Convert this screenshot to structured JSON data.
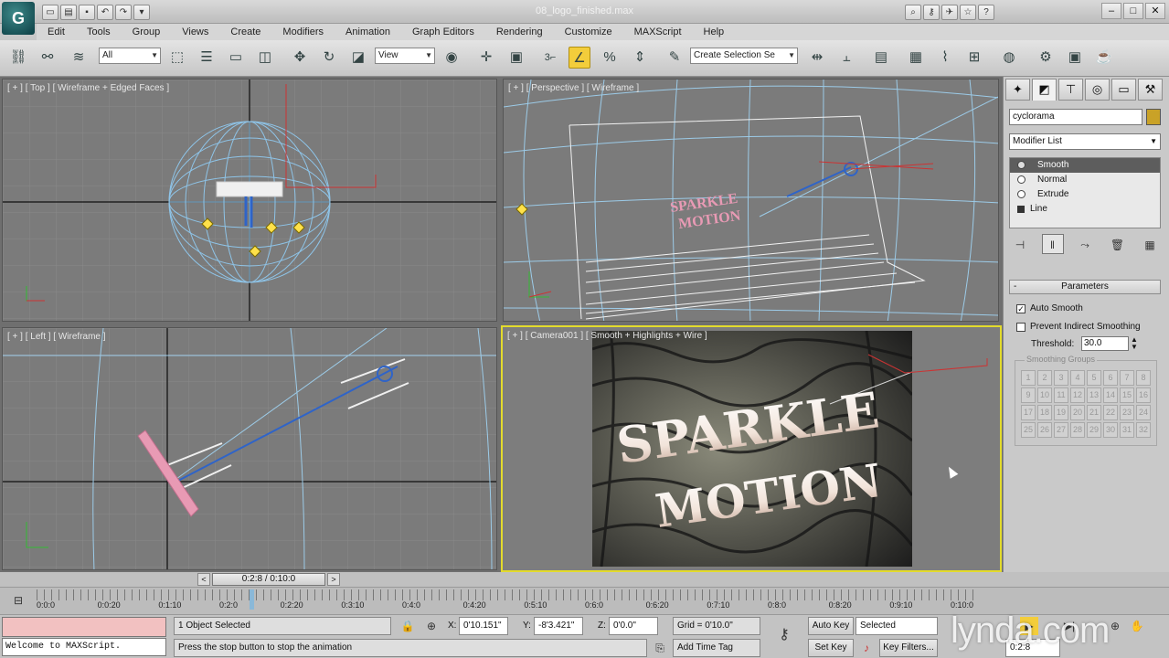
{
  "window": {
    "title": "08_logo_finished.max",
    "app_logo": "G"
  },
  "menus": [
    "Edit",
    "Tools",
    "Group",
    "Views",
    "Create",
    "Modifiers",
    "Animation",
    "Graph Editors",
    "Rendering",
    "Customize",
    "MAXScript",
    "Help"
  ],
  "toolbar": {
    "selection_filter": "All",
    "reference_coord": "View",
    "named_selection": "Create Selection Se",
    "snap_label": "3"
  },
  "viewports": {
    "top": "[ + ] [ Top ] [ Wireframe + Edged Faces ]",
    "perspective": "[ + ] [ Perspective ] [ Wireframe ]",
    "left": "[ + ] [ Left ] [ Wireframe ]",
    "camera": "[ + ] [ Camera001 ] [ Smooth + Highlights + Wire ]",
    "logo_line1": "SPARKLE",
    "logo_line2": "MOTION"
  },
  "command_panel": {
    "object_name": "cyclorama",
    "object_color": "#c9a227",
    "modifier_list": "Modifier List",
    "stack": [
      "Smooth",
      "Normal",
      "Extrude",
      "Line"
    ],
    "rollout_title": "Parameters",
    "auto_smooth": "Auto Smooth",
    "prevent_indirect": "Prevent Indirect Smoothing",
    "threshold_label": "Threshold:",
    "threshold_value": "30.0",
    "smoothing_groups_title": "Smoothing Groups",
    "smoothing_groups": [
      "1",
      "2",
      "3",
      "4",
      "5",
      "6",
      "7",
      "8",
      "9",
      "10",
      "11",
      "12",
      "13",
      "14",
      "15",
      "16",
      "17",
      "18",
      "19",
      "20",
      "21",
      "22",
      "23",
      "24",
      "25",
      "26",
      "27",
      "28",
      "29",
      "30",
      "31",
      "32"
    ]
  },
  "timeline": {
    "slider": "0:2:8 / 0:10:0",
    "ticks": [
      "0:0:0",
      "0:0:20",
      "0:1:10",
      "0:2:0",
      "0:2:20",
      "0:3:10",
      "0:4:0",
      "0:4:20",
      "0:5:10",
      "0:6:0",
      "0:6:20",
      "0:7:10",
      "0:8:0",
      "0:8:20",
      "0:9:10",
      "0:10:0"
    ],
    "current_fraction": 0.233
  },
  "status": {
    "maxscript_listener": "Welcome to MAXScript.",
    "selection": "1 Object Selected",
    "prompt": "Press the stop button to stop the animation",
    "x_label": "X:",
    "x_value": "0'10.151\"",
    "y_label": "Y:",
    "y_value": "-8'3.421\"",
    "z_label": "Z:",
    "z_value": "0'0.0\"",
    "grid": "Grid = 0'10.0\"",
    "add_time_tag": "Add Time Tag",
    "auto_key": "Auto Key",
    "set_key": "Set Key",
    "key_mode": "Selected",
    "key_filters": "Key Filters...",
    "frame_value": "0:2:8"
  },
  "watermark": "lynda.com",
  "colors": {
    "active_viewport_border": "#e3db2c",
    "wireframe_blue": "#8ec4e8",
    "text_pink": "#e89ab4"
  }
}
